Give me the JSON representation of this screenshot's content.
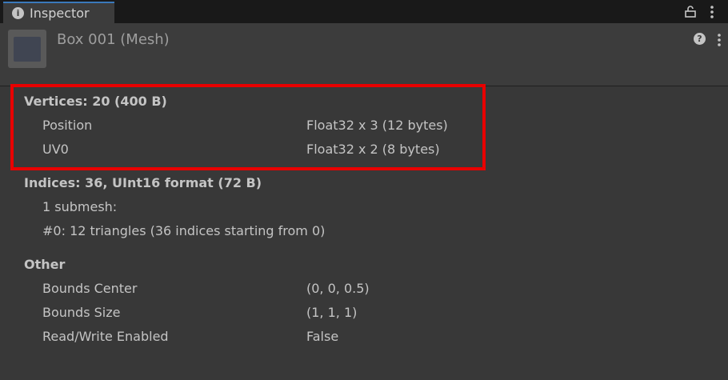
{
  "tab": {
    "label": "Inspector",
    "icon": "info-icon",
    "info_glyph": "i"
  },
  "header": {
    "title": "Box 001 (Mesh)",
    "help_glyph": "?"
  },
  "vertices": {
    "heading": "Vertices: 20 (400 B)",
    "rows": [
      {
        "label": "Position",
        "value": "Float32 x 3 (12 bytes)"
      },
      {
        "label": "UV0",
        "value": "Float32 x 2 (8 bytes)"
      }
    ]
  },
  "indices": {
    "heading": "Indices: 36, UInt16 format (72 B)",
    "lines": [
      "1 submesh:",
      "#0: 12 triangles (36 indices starting from 0)"
    ]
  },
  "other": {
    "heading": "Other",
    "rows": [
      {
        "label": "Bounds Center",
        "value": "(0, 0, 0.5)"
      },
      {
        "label": "Bounds Size",
        "value": "(1, 1, 1)"
      },
      {
        "label": "Read/Write Enabled",
        "value": "False"
      }
    ]
  },
  "colors": {
    "background": "#383838",
    "tab_accent": "#3a79bb",
    "highlight_box": "#e80000"
  }
}
